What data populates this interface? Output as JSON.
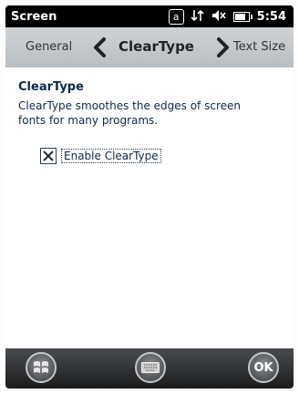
{
  "status_bar": {
    "title": "Screen",
    "time": "5:54",
    "badge": "a",
    "battery_level": 0.8,
    "icons": [
      "a-box-icon",
      "data-transfer-icon",
      "speaker-muted-icon",
      "battery-charging-icon"
    ]
  },
  "tabs": {
    "prev": "General",
    "current": "ClearType",
    "next": "Text Size"
  },
  "content": {
    "title": "ClearType",
    "description": "ClearType smoothes the edges of screen fonts for many programs.",
    "checkbox_label": "Enable ClearType",
    "checkbox_checked": true
  },
  "bottom_bar": {
    "ok_label": "OK"
  },
  "colors": {
    "status_bg": "#000000",
    "tab_bg": "#c4c8cb",
    "text_dark": "#0b2a4a",
    "bottom_bg": "#2a2b2c"
  }
}
